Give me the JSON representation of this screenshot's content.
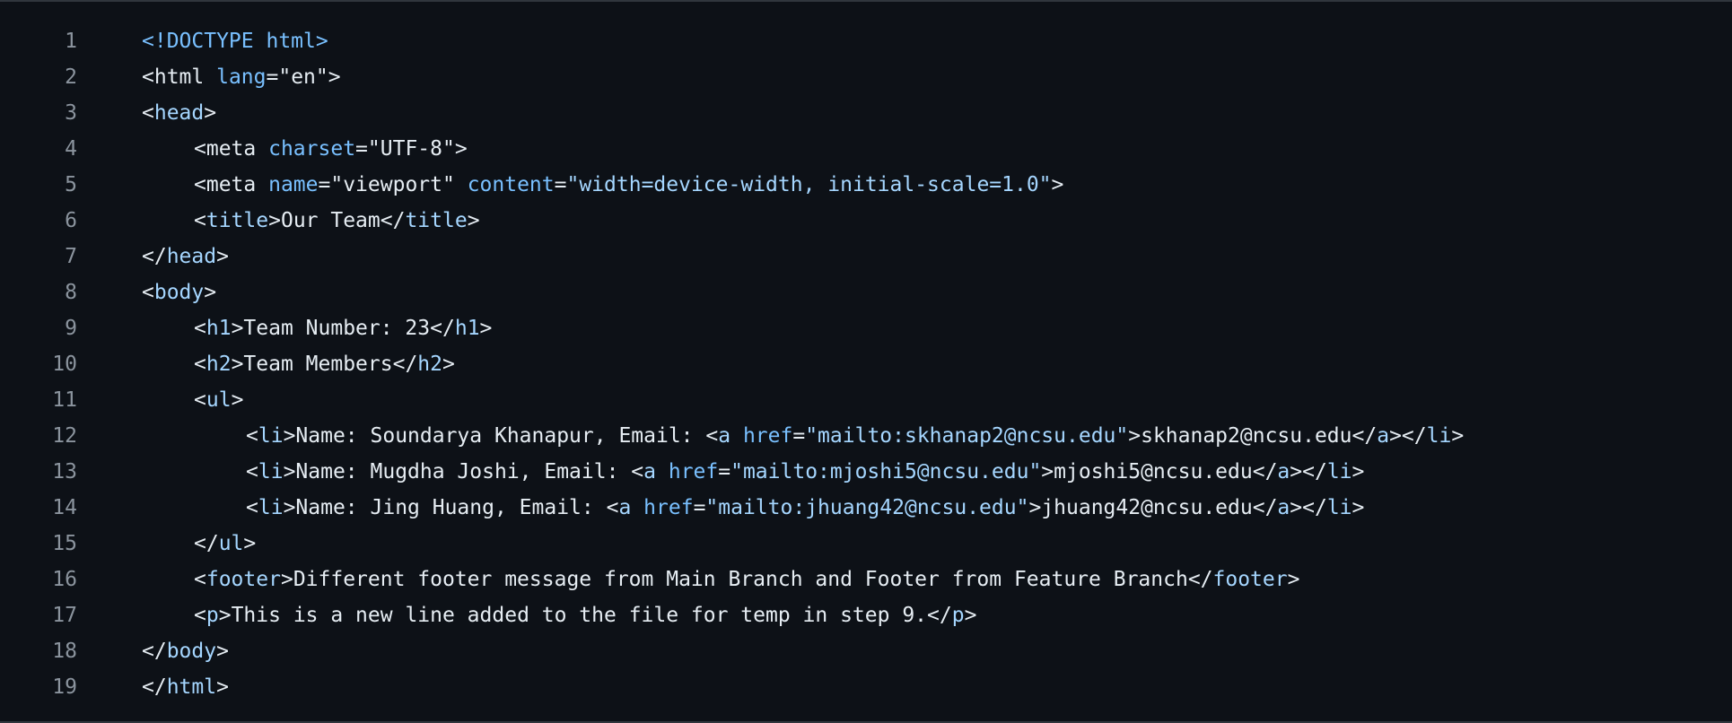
{
  "colors": {
    "background": "#0d1117",
    "line_number": "#8b949e",
    "text": "#e6edf3",
    "tag": "#a5d6ff",
    "attr": "#79c0ff",
    "string": "#a5d6ff"
  },
  "lines": [
    {
      "n": "1",
      "indent": 0,
      "tokens": [
        [
          "doct",
          "<!DOCTYPE html>"
        ]
      ]
    },
    {
      "n": "2",
      "indent": 0,
      "tokens": [
        [
          "punc",
          "<"
        ],
        [
          "txt",
          "html "
        ],
        [
          "attr",
          "lang"
        ],
        [
          "punc",
          "="
        ],
        [
          "txt",
          "\"en\""
        ],
        [
          "punc",
          ">"
        ]
      ]
    },
    {
      "n": "3",
      "indent": 0,
      "tokens": [
        [
          "punc",
          "<"
        ],
        [
          "tag",
          "head"
        ],
        [
          "punc",
          ">"
        ]
      ]
    },
    {
      "n": "4",
      "indent": 1,
      "tokens": [
        [
          "punc",
          "<"
        ],
        [
          "txt",
          "meta "
        ],
        [
          "attr",
          "charset"
        ],
        [
          "punc",
          "="
        ],
        [
          "txt",
          "\"UTF-8\""
        ],
        [
          "punc",
          ">"
        ]
      ]
    },
    {
      "n": "5",
      "indent": 1,
      "tokens": [
        [
          "punc",
          "<"
        ],
        [
          "txt",
          "meta "
        ],
        [
          "attr",
          "name"
        ],
        [
          "punc",
          "="
        ],
        [
          "txt",
          "\"viewport\" "
        ],
        [
          "attr",
          "content"
        ],
        [
          "punc",
          "="
        ],
        [
          "str",
          "\"width=device-width, initial-scale=1.0\""
        ],
        [
          "punc",
          ">"
        ]
      ]
    },
    {
      "n": "6",
      "indent": 1,
      "tokens": [
        [
          "punc",
          "<"
        ],
        [
          "tag",
          "title"
        ],
        [
          "punc",
          ">"
        ],
        [
          "txt",
          "Our Team"
        ],
        [
          "punc",
          "</"
        ],
        [
          "tag",
          "title"
        ],
        [
          "punc",
          ">"
        ]
      ]
    },
    {
      "n": "7",
      "indent": 0,
      "tokens": [
        [
          "punc",
          "</"
        ],
        [
          "tag",
          "head"
        ],
        [
          "punc",
          ">"
        ]
      ]
    },
    {
      "n": "8",
      "indent": 0,
      "tokens": [
        [
          "punc",
          "<"
        ],
        [
          "tag",
          "body"
        ],
        [
          "punc",
          ">"
        ]
      ]
    },
    {
      "n": "9",
      "indent": 1,
      "tokens": [
        [
          "punc",
          "<"
        ],
        [
          "tag",
          "h1"
        ],
        [
          "punc",
          ">"
        ],
        [
          "txt",
          "Team Number: 23"
        ],
        [
          "punc",
          "</"
        ],
        [
          "tag",
          "h1"
        ],
        [
          "punc",
          ">"
        ]
      ]
    },
    {
      "n": "10",
      "indent": 1,
      "tokens": [
        [
          "punc",
          "<"
        ],
        [
          "tag",
          "h2"
        ],
        [
          "punc",
          ">"
        ],
        [
          "txt",
          "Team Members"
        ],
        [
          "punc",
          "</"
        ],
        [
          "tag",
          "h2"
        ],
        [
          "punc",
          ">"
        ]
      ]
    },
    {
      "n": "11",
      "indent": 1,
      "tokens": [
        [
          "punc",
          "<"
        ],
        [
          "tag",
          "ul"
        ],
        [
          "punc",
          ">"
        ]
      ]
    },
    {
      "n": "12",
      "indent": 2,
      "tokens": [
        [
          "punc",
          "<"
        ],
        [
          "tag",
          "li"
        ],
        [
          "punc",
          ">"
        ],
        [
          "txt",
          "Name: Soundarya Khanapur, Email: "
        ],
        [
          "punc",
          "<"
        ],
        [
          "tag",
          "a "
        ],
        [
          "attr",
          "href"
        ],
        [
          "punc",
          "="
        ],
        [
          "str",
          "\"mailto:skhanap2@ncsu.edu\""
        ],
        [
          "punc",
          ">"
        ],
        [
          "txt",
          "skhanap2@ncsu.edu"
        ],
        [
          "punc",
          "</"
        ],
        [
          "tag",
          "a"
        ],
        [
          "punc",
          "></"
        ],
        [
          "tag",
          "li"
        ],
        [
          "punc",
          ">"
        ]
      ]
    },
    {
      "n": "13",
      "indent": 2,
      "tokens": [
        [
          "punc",
          "<"
        ],
        [
          "tag",
          "li"
        ],
        [
          "punc",
          ">"
        ],
        [
          "txt",
          "Name: Mugdha Joshi, Email: "
        ],
        [
          "punc",
          "<"
        ],
        [
          "tag",
          "a "
        ],
        [
          "attr",
          "href"
        ],
        [
          "punc",
          "="
        ],
        [
          "str",
          "\"mailto:mjoshi5@ncsu.edu\""
        ],
        [
          "punc",
          ">"
        ],
        [
          "txt",
          "mjoshi5@ncsu.edu"
        ],
        [
          "punc",
          "</"
        ],
        [
          "tag",
          "a"
        ],
        [
          "punc",
          "></"
        ],
        [
          "tag",
          "li"
        ],
        [
          "punc",
          ">"
        ]
      ]
    },
    {
      "n": "14",
      "indent": 2,
      "tokens": [
        [
          "punc",
          "<"
        ],
        [
          "tag",
          "li"
        ],
        [
          "punc",
          ">"
        ],
        [
          "txt",
          "Name: Jing Huang, Email: "
        ],
        [
          "punc",
          "<"
        ],
        [
          "tag",
          "a "
        ],
        [
          "attr",
          "href"
        ],
        [
          "punc",
          "="
        ],
        [
          "str",
          "\"mailto:jhuang42@ncsu.edu\""
        ],
        [
          "punc",
          ">"
        ],
        [
          "txt",
          "jhuang42@ncsu.edu"
        ],
        [
          "punc",
          "</"
        ],
        [
          "tag",
          "a"
        ],
        [
          "punc",
          "></"
        ],
        [
          "tag",
          "li"
        ],
        [
          "punc",
          ">"
        ]
      ]
    },
    {
      "n": "15",
      "indent": 1,
      "tokens": [
        [
          "punc",
          "</"
        ],
        [
          "tag",
          "ul"
        ],
        [
          "punc",
          ">"
        ]
      ]
    },
    {
      "n": "16",
      "indent": 1,
      "tokens": [
        [
          "punc",
          "<"
        ],
        [
          "tag",
          "footer"
        ],
        [
          "punc",
          ">"
        ],
        [
          "txt",
          "Different footer message from Main Branch and Footer from Feature Branch"
        ],
        [
          "punc",
          "</"
        ],
        [
          "tag",
          "footer"
        ],
        [
          "punc",
          ">"
        ]
      ]
    },
    {
      "n": "17",
      "indent": 1,
      "tokens": [
        [
          "punc",
          "<"
        ],
        [
          "tag",
          "p"
        ],
        [
          "punc",
          ">"
        ],
        [
          "txt",
          "This is a new line added to the file for temp in step 9."
        ],
        [
          "punc",
          "</"
        ],
        [
          "tag",
          "p"
        ],
        [
          "punc",
          ">"
        ]
      ]
    },
    {
      "n": "18",
      "indent": 0,
      "tokens": [
        [
          "punc",
          "</"
        ],
        [
          "tag",
          "body"
        ],
        [
          "punc",
          ">"
        ]
      ]
    },
    {
      "n": "19",
      "indent": 0,
      "tokens": [
        [
          "punc",
          "</"
        ],
        [
          "tag",
          "html"
        ],
        [
          "punc",
          ">"
        ]
      ]
    }
  ]
}
